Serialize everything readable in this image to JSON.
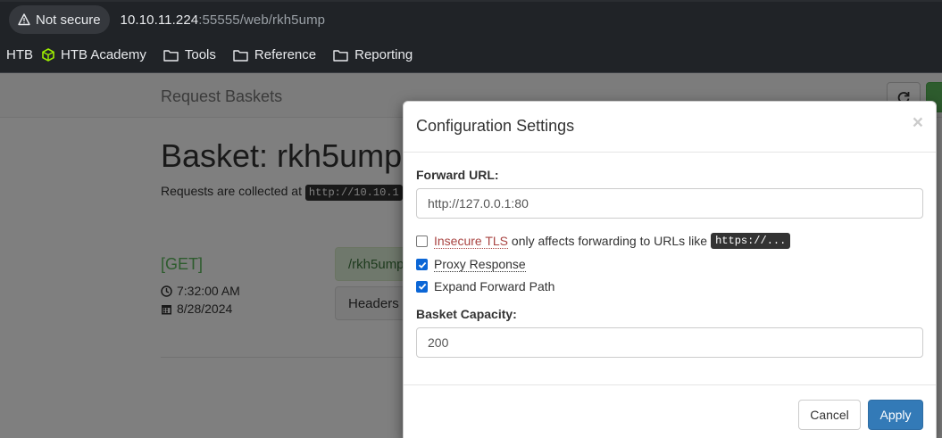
{
  "browser": {
    "security_label": "Not secure",
    "url_host": "10.10.11.224",
    "url_rest": ":55555/web/rkh5ump",
    "bookmarks": [
      {
        "label": "HTB"
      },
      {
        "label": "HTB Academy"
      },
      {
        "label": "Tools"
      },
      {
        "label": "Reference"
      },
      {
        "label": "Reporting"
      }
    ]
  },
  "page": {
    "brand": "Request Baskets",
    "basket_title": "Basket: rkh5ump",
    "collect_text": "Requests are collected at",
    "collect_url": "http://10.10.1",
    "request": {
      "method": "[GET]",
      "time": "7:32:00 AM",
      "date": "8/28/2024",
      "path": "/rkh5ump",
      "headers_label": "Headers"
    }
  },
  "modal": {
    "title": "Configuration Settings",
    "close": "×",
    "forward_url_label": "Forward URL:",
    "forward_url_value": "http://127.0.0.1:80",
    "insecure_tls": {
      "label": "Insecure TLS",
      "suffix": " only affects forwarding to URLs like",
      "code": "https://...",
      "checked": false
    },
    "proxy_response": {
      "label": "Proxy Response",
      "checked": true
    },
    "expand_forward_path": {
      "label": "Expand Forward Path",
      "checked": true
    },
    "capacity_label": "Basket Capacity:",
    "capacity_value": "200",
    "cancel_label": "Cancel",
    "apply_label": "Apply"
  },
  "colors": {
    "accent": "#337ab7",
    "success": "#5cb85c",
    "danger": "#a94442",
    "checkbox": "#0b66d6"
  },
  "icons": [
    "warning-icon",
    "hexagon-icon",
    "folder-icon",
    "refresh-icon",
    "clock-icon",
    "calendar-icon",
    "check-icon"
  ]
}
